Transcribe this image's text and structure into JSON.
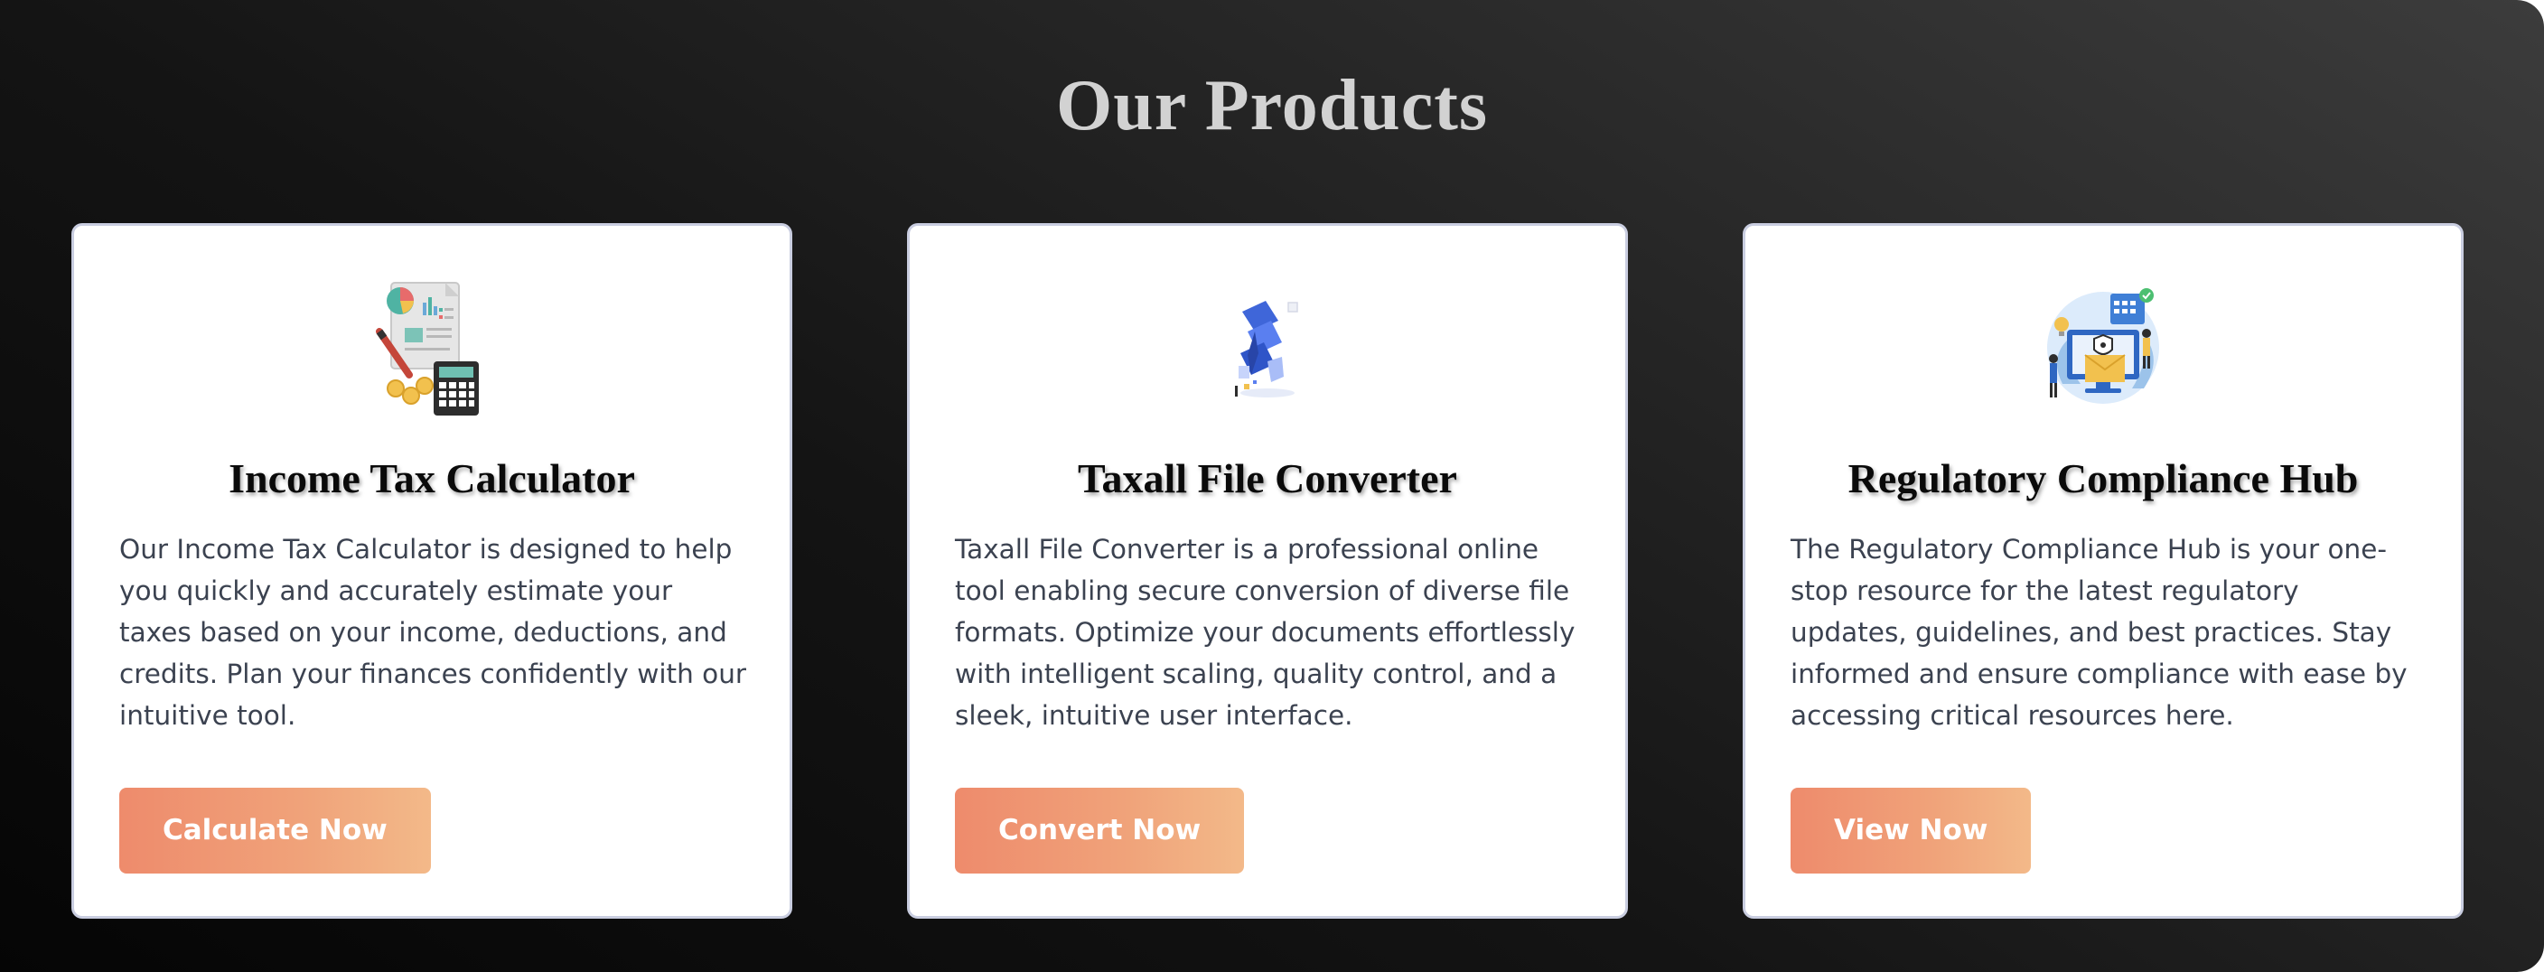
{
  "section": {
    "title": "Our Products"
  },
  "products": [
    {
      "title": "Income Tax Calculator",
      "description": "Our Income Tax Calculator is designed to help you quickly and accurately estimate your taxes based on your income, deductions, and credits. Plan your finances confidently with our intuitive tool.",
      "button_label": "Calculate Now",
      "illustration": "tax-calculator-illustration"
    },
    {
      "title": "Taxall File Converter",
      "description": "Taxall File Converter is a professional online tool enabling secure conversion of diverse file formats. Optimize your documents effortlessly with intelligent scaling, quality control, and a sleek, intuitive user interface.",
      "button_label": "Convert Now",
      "illustration": "file-converter-illustration"
    },
    {
      "title": "Regulatory Compliance Hub",
      "description": "The Regulatory Compliance Hub is your one-stop resource for the latest regulatory updates, guidelines, and best practices. Stay informed and ensure compliance with ease by accessing critical resources here.",
      "button_label": "View Now",
      "illustration": "compliance-hub-illustration"
    }
  ],
  "colors": {
    "background_dark": "#050505",
    "background_light": "#3c3c3c",
    "title_text": "#d2d2d2",
    "card_border": "#c9cde0",
    "button_start": "#ee8b6c",
    "button_end": "#f3b989",
    "description_text": "#3b4250"
  }
}
